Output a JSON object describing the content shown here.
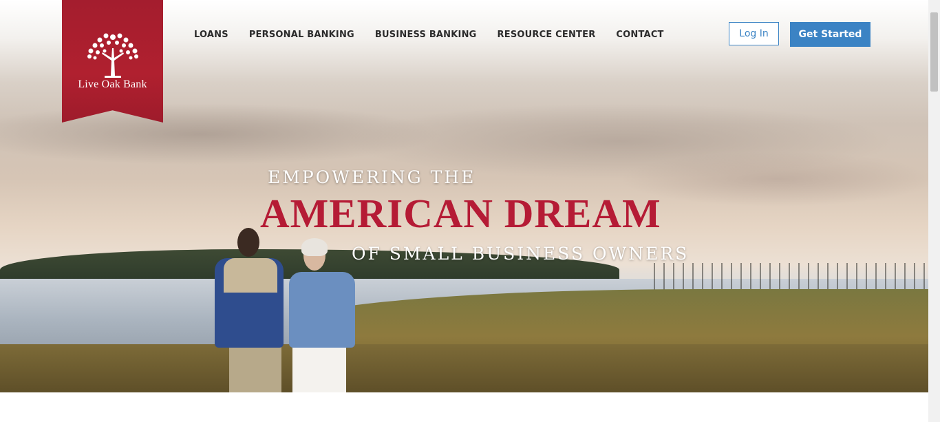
{
  "brand": {
    "name": "Live Oak Bank",
    "color": "#a41d2e"
  },
  "nav": {
    "items": [
      {
        "label": "LOANS"
      },
      {
        "label": "PERSONAL BANKING"
      },
      {
        "label": "BUSINESS BANKING"
      },
      {
        "label": "RESOURCE CENTER"
      },
      {
        "label": "CONTACT"
      }
    ]
  },
  "header": {
    "login_label": "Log In",
    "get_started_label": "Get Started",
    "accent": "#3b83c4"
  },
  "hero": {
    "line1": "EMPOWERING THE",
    "line2": "AMERICAN DREAM",
    "line3": "OF SMALL BUSINESS OWNERS"
  }
}
